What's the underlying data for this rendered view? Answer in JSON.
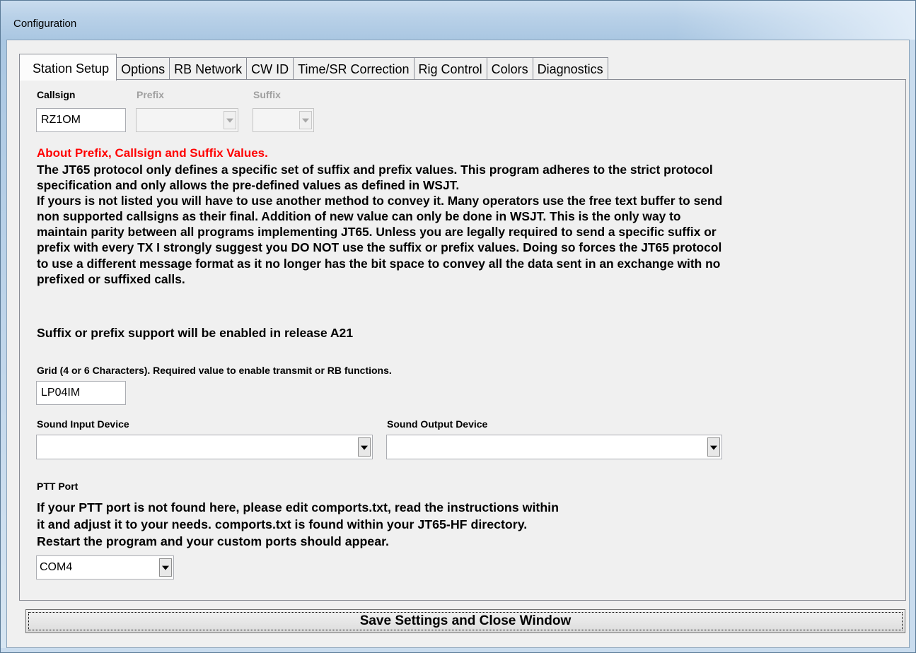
{
  "window": {
    "title": "Configuration"
  },
  "tabs": [
    "Station Setup",
    "Options",
    "RB Network",
    "CW ID",
    "Time/SR Correction",
    "Rig Control",
    "Colors",
    "Diagnostics"
  ],
  "active_tab": "Station Setup",
  "callsign": {
    "label": "Callsign",
    "value": "RZ1OM"
  },
  "prefix": {
    "label": "Prefix",
    "value": "",
    "enabled": false
  },
  "suffix": {
    "label": "Suffix",
    "value": "",
    "enabled": false
  },
  "about": {
    "heading": "About Prefix, Callsign and Suffix Values.",
    "body": "The JT65 protocol only defines a specific set of suffix and prefix values.  This program adheres to the strict protocol\nspecification and only allows the pre-defined values as defined in WSJT.\nIf yours is not listed you will have to use another method to convey it.  Many operators use the free text buffer to send\nnon supported callsigns as their final.  Addition of new value can only be done in WSJT.  This is the only way to\nmaintain parity between all programs implementing JT65.  Unless you are legally required to send a specific suffix or\nprefix with every TX I strongly suggest you DO NOT use the suffix or prefix values.  Doing so forces the JT65 protocol\nto use a different message format as it no longer has the bit space to convey all the data sent in an exchange with no\nprefixed or suffixed calls.",
    "release_note": "Suffix or prefix support will be enabled in release A21"
  },
  "grid": {
    "label": "Grid (4 or 6 Characters).  Required value to enable transmit or RB functions.",
    "value": "LP04IM"
  },
  "sound_input": {
    "label": "Sound Input Device",
    "value": ""
  },
  "sound_output": {
    "label": "Sound Output Device",
    "value": ""
  },
  "ptt": {
    "label": "PTT Port",
    "help": "If your PTT port is not found here, please edit comports.txt, read the instructions within\nit and adjust it to your needs.  comports.txt is found within your JT65-HF directory.\nRestart the program and your custom ports should appear.",
    "value": "COM4"
  },
  "save_button": "Save Settings and Close Window"
}
